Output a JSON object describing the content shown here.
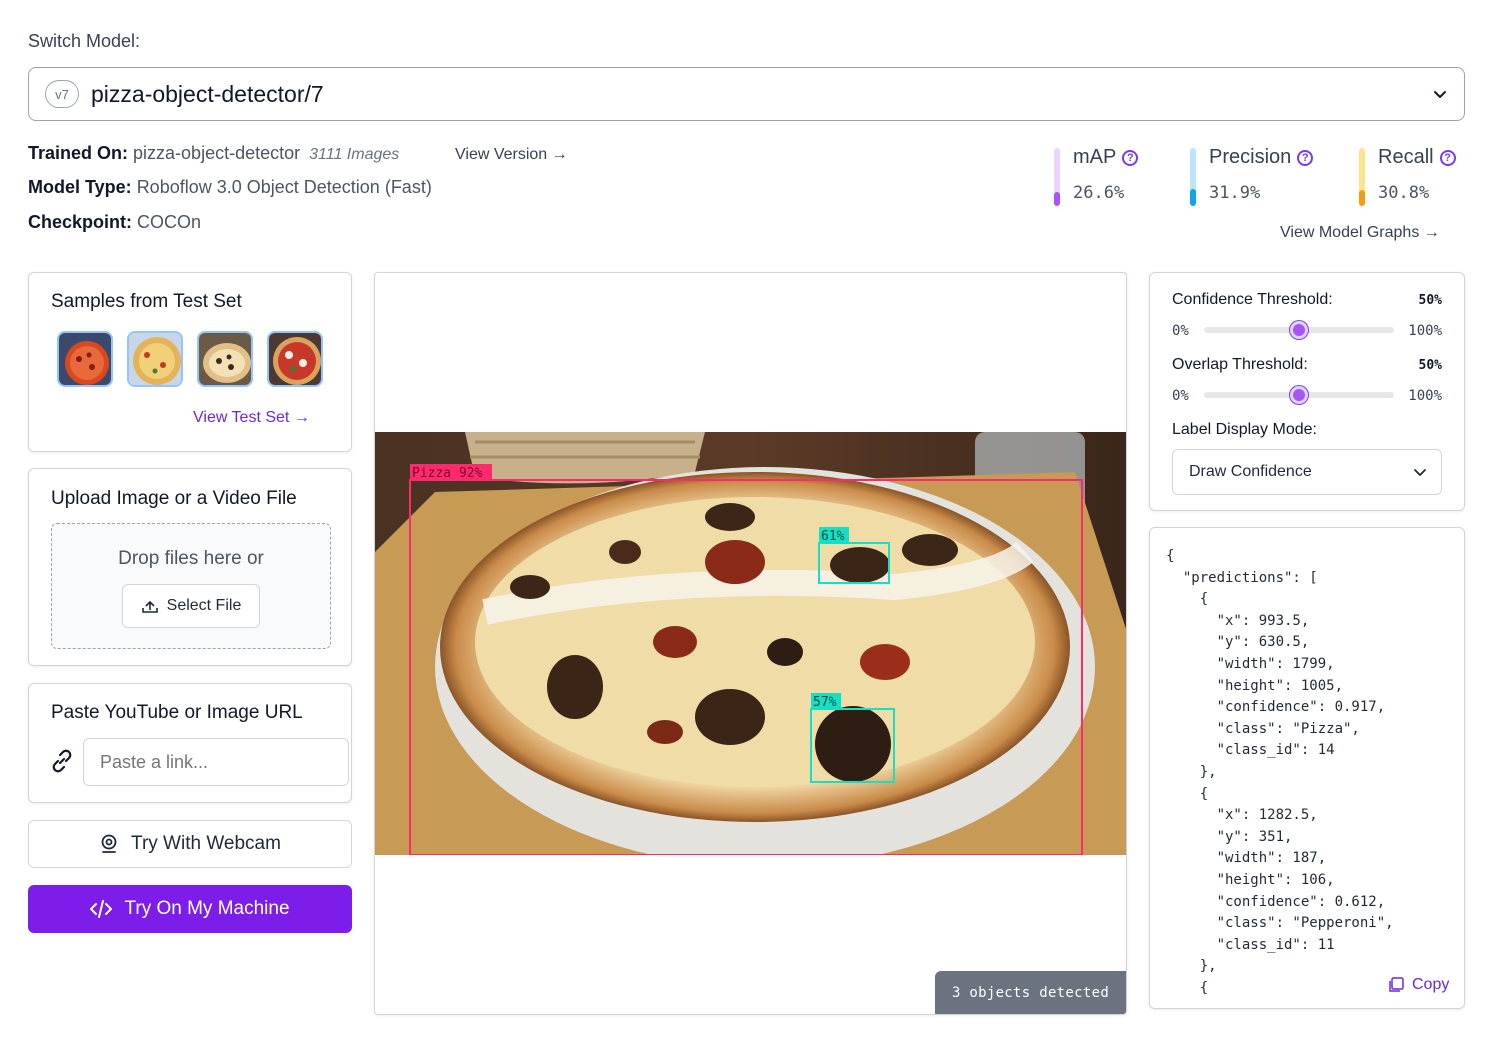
{
  "header": {
    "switch_label": "Switch Model:",
    "version_badge": "v7",
    "model_name": "pizza-object-detector/7"
  },
  "info": {
    "trained_label": "Trained On:",
    "trained_value": "pizza-object-detector",
    "images_count": "3111 Images",
    "view_version": "View Version",
    "type_label": "Model Type:",
    "type_value": "Roboflow 3.0 Object Detection (Fast)",
    "checkpoint_label": "Checkpoint:",
    "checkpoint_value": "COCOn"
  },
  "metrics": [
    {
      "label": "mAP",
      "value": "26.6%",
      "color": "#a855f7",
      "track": "#e9d5ff",
      "fraction": 0.266
    },
    {
      "label": "Precision",
      "value": "31.9%",
      "color": "#0ea5e9",
      "track": "#bae6fd",
      "fraction": 0.319
    },
    {
      "label": "Recall",
      "value": "30.8%",
      "color": "#f59e0b",
      "track": "#fde68a",
      "fraction": 0.308
    }
  ],
  "view_graphs": "View Model Graphs",
  "samples": {
    "title": "Samples from Test Set",
    "link": "View Test Set"
  },
  "upload": {
    "title": "Upload Image or a Video File",
    "drop_text": "Drop files here or",
    "select_file": "Select File"
  },
  "url": {
    "title": "Paste YouTube or Image URL",
    "placeholder": "Paste a link..."
  },
  "buttons": {
    "webcam": "Try With Webcam",
    "machine": "Try On My Machine"
  },
  "detections": [
    {
      "label": "Pizza 92%",
      "color": "#ff2a6d",
      "text_color": "#7f0030"
    },
    {
      "label": "61%",
      "color": "#14e0c8",
      "text_color": "#064e3b"
    },
    {
      "label": "57%",
      "color": "#14e0c8",
      "text_color": "#064e3b"
    }
  ],
  "objects_badge": "3 objects detected",
  "controls": {
    "confidence_label": "Confidence Threshold:",
    "confidence_value": "50%",
    "confidence_fraction": 0.5,
    "overlap_label": "Overlap Threshold:",
    "overlap_value": "50%",
    "overlap_fraction": 0.5,
    "range_min": "0%",
    "range_max": "100%",
    "mode_label": "Label Display Mode:",
    "mode_value": "Draw Confidence"
  },
  "json_output": "{\n  \"predictions\": [\n    {\n      \"x\": 993.5,\n      \"y\": 630.5,\n      \"width\": 1799,\n      \"height\": 1005,\n      \"confidence\": 0.917,\n      \"class\": \"Pizza\",\n      \"class_id\": 14\n    },\n    {\n      \"x\": 1282.5,\n      \"y\": 351,\n      \"width\": 187,\n      \"height\": 106,\n      \"confidence\": 0.612,\n      \"class\": \"Pepperoni\",\n      \"class_id\": 11\n    },\n    {",
  "copy_label": "Copy"
}
